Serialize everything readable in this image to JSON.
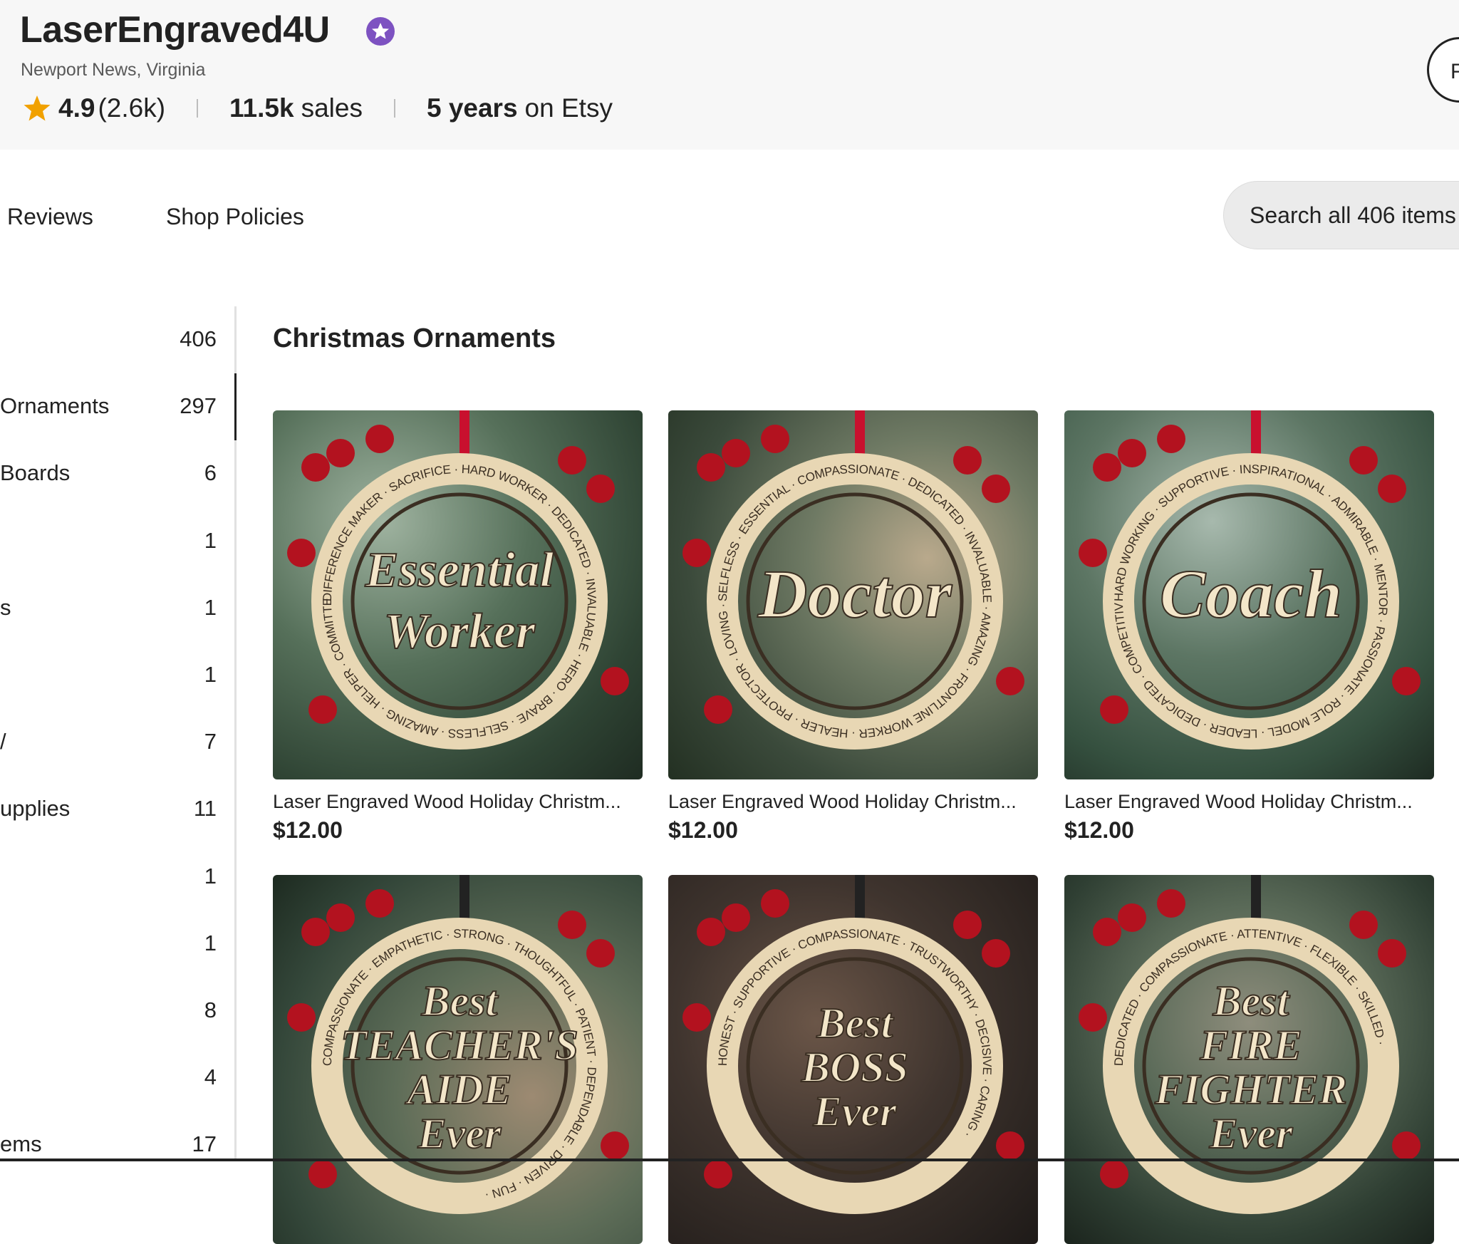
{
  "shop": {
    "name": "LaserEngraved4U",
    "location": "Newport News, Virginia",
    "rating": "4.9",
    "review_count": "(2.6k)",
    "sales_number": "11.5k",
    "sales_word": "sales",
    "years_number": "5 years",
    "years_suffix": "on Etsy",
    "follow_label": "F"
  },
  "icons": {
    "star_seller": "star-seller-badge-icon",
    "rating_star": "star-icon",
    "rating_star_color": "#f1a100",
    "star_seller_color": "#7d52c1"
  },
  "tabs": [
    {
      "label": "Reviews"
    },
    {
      "label": "Shop Policies"
    }
  ],
  "search": {
    "placeholder": "Search all 406 items"
  },
  "sidebar": {
    "items": [
      {
        "label": "",
        "count": "406"
      },
      {
        "label": "Ornaments",
        "count": "297"
      },
      {
        "label": "Boards",
        "count": "6"
      },
      {
        "label": "",
        "count": "1"
      },
      {
        "label": "s",
        "count": "1"
      },
      {
        "label": "",
        "count": "1"
      },
      {
        "label": "/",
        "count": "7"
      },
      {
        "label": "upplies",
        "count": "11"
      },
      {
        "label": "",
        "count": "1"
      },
      {
        "label": "",
        "count": "1"
      },
      {
        "label": "",
        "count": "8"
      },
      {
        "label": "",
        "count": "4"
      },
      {
        "label": "ems",
        "count": "17"
      }
    ]
  },
  "section": {
    "title": "Christmas Ornaments"
  },
  "listings": [
    {
      "title": "Laser Engraved Wood Holiday Christm...",
      "price": "$12.00",
      "ornament_text": "Essential Worker",
      "ring_words": "DIFFERENCE MAKER · SACRIFICE · HARD WORKER · DEDICATED · INVALUABLE · HERO · BRAVE · SELFLESS · AMAZING · HELPER · COMMITTED ·"
    },
    {
      "title": "Laser Engraved Wood Holiday Christm...",
      "price": "$12.00",
      "ornament_text": "Doctor",
      "ring_words": "SELFLESS · ESSENTIAL · COMPASSIONATE · DEDICATED · INVALUABLE · AMAZING · FRONTLINE WORKER · HEALER · PROTECTOR · LOVING ·"
    },
    {
      "title": "Laser Engraved Wood Holiday Christm...",
      "price": "$12.00",
      "ornament_text": "Coach",
      "ring_words": "HARD WORKING · SUPPORTIVE · INSPIRATIONAL · ADMIRABLE · MENTOR · PASSIONATE · ROLE MODEL · LEADER · DEDICATED · COMPETITIVE ·"
    },
    {
      "title": "",
      "price": "",
      "ornament_text": "Best TEACHER'S AIDE Ever",
      "ring_words": "COMPASSIONATE · EMPATHETIC · STRONG · THOUGHTFUL · PATIENT · DEPENDABLE · DRIVEN · FUN ·"
    },
    {
      "title": "",
      "price": "",
      "ornament_text": "Best BOSS Ever",
      "ring_words": "HONEST · SUPPORTIVE · COMPASSIONATE · TRUSTWORTHY · DECISIVE · CARING ·"
    },
    {
      "title": "",
      "price": "",
      "ornament_text": "Best FIRE FIGHTER Ever",
      "ring_words": "DEDICATED · COMPASSIONATE · ATTENTIVE · FLEXIBLE · SKILLED ·"
    }
  ]
}
